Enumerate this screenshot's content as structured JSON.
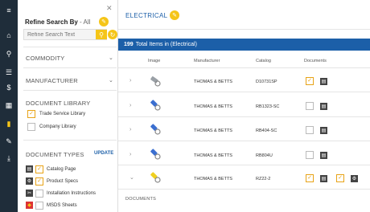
{
  "rail": {
    "items": [
      {
        "icon": "menu-icon",
        "glyph": "≡"
      },
      {
        "icon": "home-icon",
        "glyph": "⌂"
      },
      {
        "icon": "search-icon",
        "glyph": "⚲"
      },
      {
        "icon": "list-icon",
        "glyph": "☰"
      },
      {
        "icon": "dollar-icon",
        "glyph": "$"
      },
      {
        "icon": "calculator-icon",
        "glyph": "▦"
      },
      {
        "icon": "book-icon",
        "glyph": "▮"
      },
      {
        "icon": "wrench-icon",
        "glyph": "✎"
      },
      {
        "icon": "download-icon",
        "glyph": "⤓"
      }
    ],
    "active_index": 6
  },
  "panel": {
    "title": "Refine Search By",
    "title_sub": "- All",
    "search_placeholder": "Refine Search Text",
    "commodity": "COMMODITY",
    "manufacturer": "MANUFACTURER",
    "library_head": "DOCUMENT LIBRARY",
    "library_items": [
      {
        "label": "Trade Service Library",
        "checked": true
      },
      {
        "label": "Company Library",
        "checked": false
      }
    ],
    "doc_types_head": "DOCUMENT TYPES",
    "update_label": "UPDATE",
    "doc_types": [
      {
        "label": "Catalog Page",
        "checked": true,
        "icon": "document-icon"
      },
      {
        "label": "Product Specs",
        "checked": true,
        "icon": "gear-icon"
      },
      {
        "label": "Installation Instructions",
        "checked": false,
        "icon": "tools-icon"
      },
      {
        "label": "MSDS Sheets",
        "checked": false,
        "icon": "diamond-icon"
      }
    ]
  },
  "main": {
    "title": "ELECTRICAL",
    "count": "199",
    "count_label": "Total Items in (Electrical)",
    "columns": {
      "image": "Image",
      "manufacturer": "Manufacturer",
      "catalog": "Catalog",
      "documents": "Documents"
    },
    "rows": [
      {
        "manufacturer": "THOMAS & BETTS",
        "catalog": "D10731SP",
        "expanded": false,
        "thumb_color": "#9aa0a6",
        "docs": {
          "checked": true,
          "extra": false
        }
      },
      {
        "manufacturer": "THOMAS & BETTS",
        "catalog": "RB1323-SC",
        "expanded": false,
        "thumb_color": "#3b6fd0",
        "docs": {
          "checked": false,
          "extra": false
        }
      },
      {
        "manufacturer": "THOMAS & BETTS",
        "catalog": "RB404-SC",
        "expanded": false,
        "thumb_color": "#3b6fd0",
        "docs": {
          "checked": false,
          "extra": false
        }
      },
      {
        "manufacturer": "THOMAS & BETTS",
        "catalog": "RB804U",
        "expanded": false,
        "thumb_color": "#3b6fd0",
        "docs": {
          "checked": false,
          "extra": false
        }
      },
      {
        "manufacturer": "THOMAS & BETTS",
        "catalog": "RZ22-2",
        "expanded": true,
        "thumb_color": "#f0d020",
        "docs": {
          "checked": true,
          "extra": true
        }
      }
    ],
    "documents_label": "DOCUMENTS"
  },
  "colors": {
    "accent": "#f5c518",
    "brand_blue": "#1c5fa8",
    "rail": "#1f2d3a"
  }
}
